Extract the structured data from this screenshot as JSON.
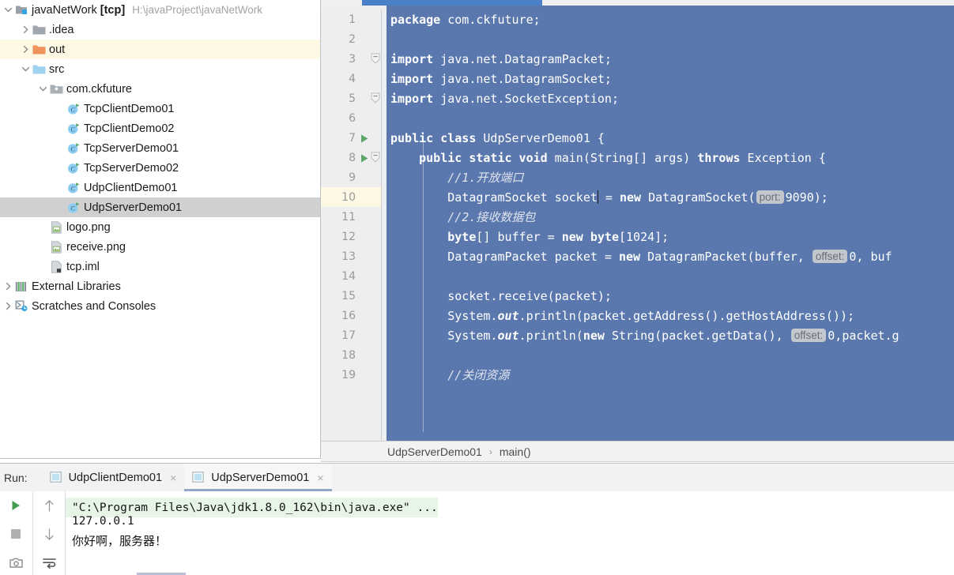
{
  "project": {
    "root": {
      "name": "javaNetWork",
      "module": "[tcp]",
      "path": "H:\\javaProject\\javaNetWork"
    },
    "items": [
      {
        "label": ".idea",
        "icon": "folder-grey-icon",
        "depth": 1,
        "twisty": "chevron-right",
        "state": "normal"
      },
      {
        "label": "out",
        "icon": "folder-orange-icon",
        "depth": 1,
        "twisty": "chevron-right",
        "state": "excluded"
      },
      {
        "label": "src",
        "icon": "folder-blue-icon",
        "depth": 1,
        "twisty": "chevron-down",
        "state": "normal"
      },
      {
        "label": "com.ckfuture",
        "icon": "package-icon",
        "depth": 2,
        "twisty": "chevron-down",
        "state": "normal"
      },
      {
        "label": "TcpClientDemo01",
        "icon": "java-class-run-icon",
        "depth": 3,
        "twisty": "",
        "state": "normal"
      },
      {
        "label": "TcpClientDemo02",
        "icon": "java-class-run-icon",
        "depth": 3,
        "twisty": "",
        "state": "normal"
      },
      {
        "label": "TcpServerDemo01",
        "icon": "java-class-run-icon",
        "depth": 3,
        "twisty": "",
        "state": "normal"
      },
      {
        "label": "TcpServerDemo02",
        "icon": "java-class-run-icon",
        "depth": 3,
        "twisty": "",
        "state": "normal"
      },
      {
        "label": "UdpClientDemo01",
        "icon": "java-class-run-icon",
        "depth": 3,
        "twisty": "",
        "state": "normal"
      },
      {
        "label": "UdpServerDemo01",
        "icon": "java-class-run-icon",
        "depth": 3,
        "twisty": "",
        "state": "selected"
      },
      {
        "label": "logo.png",
        "icon": "image-file-icon",
        "depth": 2,
        "twisty": "",
        "state": "normal"
      },
      {
        "label": "receive.png",
        "icon": "image-file-icon",
        "depth": 2,
        "twisty": "",
        "state": "normal"
      },
      {
        "label": "tcp.iml",
        "icon": "iml-file-icon",
        "depth": 2,
        "twisty": "",
        "state": "normal"
      },
      {
        "label": "External Libraries",
        "icon": "libraries-icon",
        "depth": 0,
        "twisty": "chevron-right",
        "state": "normal"
      },
      {
        "label": "Scratches and Consoles",
        "icon": "scratches-icon",
        "depth": 0,
        "twisty": "chevron-right",
        "state": "normal"
      }
    ]
  },
  "editor": {
    "current_line": 10,
    "run_marker_lines": [
      7,
      8
    ],
    "fold_lines": [
      3,
      5,
      8
    ],
    "lines": [
      {
        "n": 1,
        "tokens": [
          {
            "t": "kw",
            "v": "package"
          },
          {
            "t": "p",
            "v": " com.ckfuture;"
          }
        ]
      },
      {
        "n": 2,
        "tokens": []
      },
      {
        "n": 3,
        "tokens": [
          {
            "t": "kw",
            "v": "import"
          },
          {
            "t": "p",
            "v": " java.net.DatagramPacket;"
          }
        ]
      },
      {
        "n": 4,
        "tokens": [
          {
            "t": "kw",
            "v": "import"
          },
          {
            "t": "p",
            "v": " java.net.DatagramSocket;"
          }
        ]
      },
      {
        "n": 5,
        "tokens": [
          {
            "t": "kw",
            "v": "import"
          },
          {
            "t": "p",
            "v": " java.net.SocketException;"
          }
        ]
      },
      {
        "n": 6,
        "tokens": []
      },
      {
        "n": 7,
        "tokens": [
          {
            "t": "kw",
            "v": "public class"
          },
          {
            "t": "p",
            "v": " UdpServerDemo01 {"
          }
        ]
      },
      {
        "n": 8,
        "tokens": [
          {
            "t": "p",
            "v": "    "
          },
          {
            "t": "kw",
            "v": "public static void"
          },
          {
            "t": "p",
            "v": " main(String[] args) "
          },
          {
            "t": "kw",
            "v": "throws"
          },
          {
            "t": "p",
            "v": " Exception {"
          }
        ]
      },
      {
        "n": 9,
        "tokens": [
          {
            "t": "p",
            "v": "        "
          },
          {
            "t": "cmt",
            "v": "//1.开放端口"
          }
        ]
      },
      {
        "n": 10,
        "tokens": [
          {
            "t": "p",
            "v": "        DatagramSocket socket"
          },
          {
            "t": "caret",
            "v": ""
          },
          {
            "t": "p",
            "v": " = "
          },
          {
            "t": "kw",
            "v": "new"
          },
          {
            "t": "p",
            "v": " DatagramSocket("
          },
          {
            "t": "hint",
            "v": "port:"
          },
          {
            "t": "p",
            "v": "9090);"
          }
        ]
      },
      {
        "n": 11,
        "tokens": [
          {
            "t": "p",
            "v": "        "
          },
          {
            "t": "cmt",
            "v": "//2.接收数据包"
          }
        ]
      },
      {
        "n": 12,
        "tokens": [
          {
            "t": "p",
            "v": "        "
          },
          {
            "t": "kw",
            "v": "byte"
          },
          {
            "t": "p",
            "v": "[] buffer = "
          },
          {
            "t": "kw",
            "v": "new"
          },
          {
            "t": "p",
            "v": " "
          },
          {
            "t": "kw",
            "v": "byte"
          },
          {
            "t": "p",
            "v": "[1024];"
          }
        ]
      },
      {
        "n": 13,
        "tokens": [
          {
            "t": "p",
            "v": "        DatagramPacket packet = "
          },
          {
            "t": "kw",
            "v": "new"
          },
          {
            "t": "p",
            "v": " DatagramPacket(buffer, "
          },
          {
            "t": "hint",
            "v": "offset:"
          },
          {
            "t": "p",
            "v": "0, buf"
          }
        ]
      },
      {
        "n": 14,
        "tokens": []
      },
      {
        "n": 15,
        "tokens": [
          {
            "t": "p",
            "v": "        socket.receive(packet);"
          }
        ]
      },
      {
        "n": 16,
        "tokens": [
          {
            "t": "p",
            "v": "        System."
          },
          {
            "t": "fld",
            "v": "out"
          },
          {
            "t": "p",
            "v": ".println(packet.getAddress().getHostAddress());"
          }
        ]
      },
      {
        "n": 17,
        "tokens": [
          {
            "t": "p",
            "v": "        System."
          },
          {
            "t": "fld",
            "v": "out"
          },
          {
            "t": "p",
            "v": ".println("
          },
          {
            "t": "kw",
            "v": "new"
          },
          {
            "t": "p",
            "v": " String(packet.getData(), "
          },
          {
            "t": "hint",
            "v": "offset:"
          },
          {
            "t": "p",
            "v": "0,packet.g"
          }
        ]
      },
      {
        "n": 18,
        "tokens": []
      },
      {
        "n": 19,
        "tokens": [
          {
            "t": "p",
            "v": "        "
          },
          {
            "t": "cmt",
            "v": "//关闭资源"
          }
        ]
      }
    ]
  },
  "breadcrumb": {
    "class": "UdpServerDemo01",
    "separator": "›",
    "method": "main()"
  },
  "run_window": {
    "label": "Run:",
    "tabs": [
      {
        "title": "UdpClientDemo01",
        "active": false,
        "close": "×"
      },
      {
        "title": "UdpServerDemo01",
        "active": true,
        "close": "×"
      }
    ],
    "toolbar_left": [
      {
        "icon": "rerun-play-icon"
      },
      {
        "icon": "stop-icon"
      },
      {
        "icon": "camera-icon"
      }
    ],
    "toolbar_right": [
      {
        "icon": "arrow-up-icon"
      },
      {
        "icon": "arrow-down-icon"
      },
      {
        "icon": "soft-wrap-icon"
      }
    ],
    "console": [
      {
        "text": "\"C:\\Program Files\\Java\\jdk1.8.0_162\\bin\\java.exe\" ...",
        "kind": "command"
      },
      {
        "text": "127.0.0.1",
        "kind": "output"
      },
      {
        "text": "你好啊，服务器！",
        "kind": "output-cjk"
      }
    ]
  },
  "colors": {
    "editor_selection_bg": "#5a78ad",
    "gutter_bg": "#eeeeee",
    "current_line_bg": "#fdf8e3",
    "tree_selected_bg": "#d0d0d0",
    "tree_excluded_bg": "#fdf8e3",
    "run_accent": "#4a80c8",
    "console_command_bg": "#e7f5e7",
    "run_play_green": "#499c54",
    "folder_orange": "#f0925b",
    "folder_blue": "#9fd2ee"
  }
}
